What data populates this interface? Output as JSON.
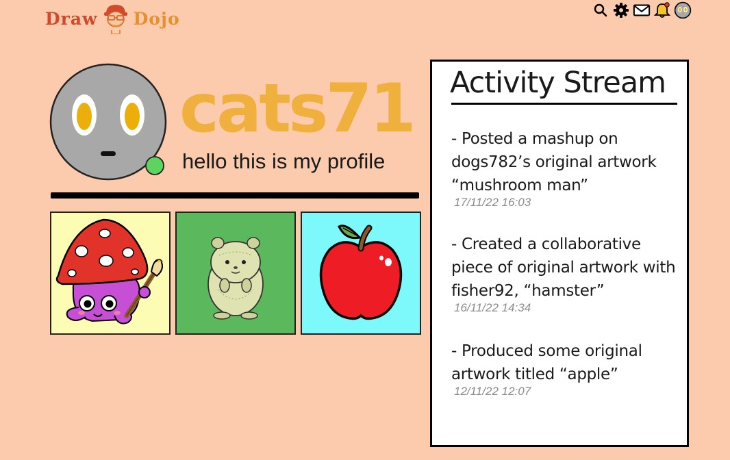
{
  "header": {
    "logo": {
      "word1": "Draw",
      "word2": "Dojo",
      "mascot_icon": "bearded-face-icon"
    },
    "icons": [
      "search-icon",
      "settings-gear-icon",
      "mail-icon",
      "notification-bell-icon",
      "user-avatar-icon"
    ]
  },
  "profile": {
    "username": "cats71",
    "bio": "hello this is my profile",
    "status": "online",
    "status_color": "#5fd35f",
    "username_color": "#f0b03d"
  },
  "gallery": [
    {
      "title": "mushroom man",
      "background": "#fdfcb5"
    },
    {
      "title": "hamster",
      "background": "#5cb85c"
    },
    {
      "title": "apple",
      "background": "#7df8fb"
    }
  ],
  "activity": {
    "title": "Activity Stream",
    "entries": [
      {
        "text": "- Posted a mashup on dogs782’s original artwork “mushroom man”",
        "timestamp": "17/11/22 16:03"
      },
      {
        "text": "- Created a collaborative piece of original artwork with fisher92, “hamster”",
        "timestamp": "16/11/22 14:34"
      },
      {
        "text": "- Produced some original artwork titled “apple”",
        "timestamp": "12/11/22 12:07"
      }
    ]
  }
}
